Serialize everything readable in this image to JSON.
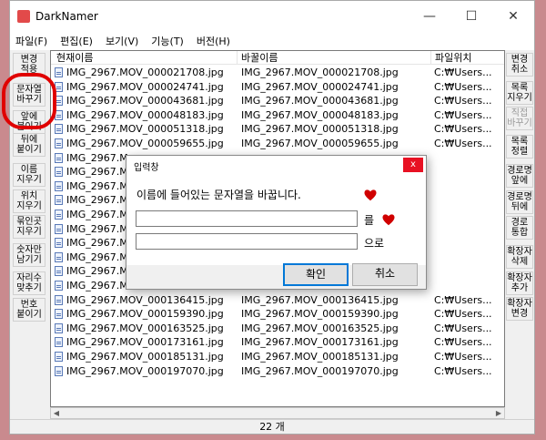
{
  "window": {
    "title": "DarkNamer",
    "controls": {
      "minimize": "—",
      "maximize": "☐",
      "close": "✕"
    }
  },
  "menu": [
    "파일(F)",
    "편집(E)",
    "보기(V)",
    "기능(T)",
    "버전(H)"
  ],
  "left_buttons": [
    {
      "label": "변경\n적용",
      "enabled": true
    },
    {
      "label": "문자열\n바꾸기",
      "enabled": true
    },
    {
      "label": "앞에\n붙이기",
      "enabled": true
    },
    {
      "label": "뒤에\n붙이기",
      "enabled": true
    },
    {
      "label": "이름\n지우기",
      "enabled": true
    },
    {
      "label": "위치\n지우기",
      "enabled": true
    },
    {
      "label": "묶인곳\n지우기",
      "enabled": true
    },
    {
      "label": "숫자만\n남기기",
      "enabled": true
    },
    {
      "label": "자리수\n맞추기",
      "enabled": true
    },
    {
      "label": "번호\n붙이기",
      "enabled": true
    }
  ],
  "right_buttons": [
    {
      "label": "변경\n취소",
      "enabled": true
    },
    {
      "label": "목록\n지우기",
      "enabled": true
    },
    {
      "label": "직접\n바꾸기",
      "enabled": false
    },
    {
      "label": "목록\n정렬",
      "enabled": true
    },
    {
      "label": "경로명\n앞에",
      "enabled": true
    },
    {
      "label": "경로명\n뒤에",
      "enabled": true
    },
    {
      "label": "경로\n통합",
      "enabled": true
    },
    {
      "label": "확장자\n삭제",
      "enabled": true
    },
    {
      "label": "확장자\n추가",
      "enabled": true
    },
    {
      "label": "확장자\n변경",
      "enabled": true
    }
  ],
  "list": {
    "columns": [
      "현재이름",
      "바꿀이름",
      "파일위치"
    ],
    "rows": [
      {
        "current": "IMG_2967.MOV_000021708.jpg",
        "new": "IMG_2967.MOV_000021708.jpg",
        "path": "C:₩Users..."
      },
      {
        "current": "IMG_2967.MOV_000024741.jpg",
        "new": "IMG_2967.MOV_000024741.jpg",
        "path": "C:₩Users..."
      },
      {
        "current": "IMG_2967.MOV_000043681.jpg",
        "new": "IMG_2967.MOV_000043681.jpg",
        "path": "C:₩Users..."
      },
      {
        "current": "IMG_2967.MOV_000048183.jpg",
        "new": "IMG_2967.MOV_000048183.jpg",
        "path": "C:₩Users..."
      },
      {
        "current": "IMG_2967.MOV_000051318.jpg",
        "new": "IMG_2967.MOV_000051318.jpg",
        "path": "C:₩Users..."
      },
      {
        "current": "IMG_2967.MOV_000059655.jpg",
        "new": "IMG_2967.MOV_000059655.jpg",
        "path": "C:₩Users..."
      },
      {
        "current": "IMG_2967.M",
        "new": "",
        "path": ""
      },
      {
        "current": "IMG_2967.M",
        "new": "",
        "path": ""
      },
      {
        "current": "IMG_2967.M",
        "new": "",
        "path": ""
      },
      {
        "current": "IMG_2967.M",
        "new": "",
        "path": ""
      },
      {
        "current": "IMG_2967.M",
        "new": "",
        "path": ""
      },
      {
        "current": "IMG_2967.M",
        "new": "",
        "path": ""
      },
      {
        "current": "IMG_2967.M",
        "new": "",
        "path": ""
      },
      {
        "current": "IMG_2967.M",
        "new": "",
        "path": ""
      },
      {
        "current": "IMG_2967.M",
        "new": "",
        "path": ""
      },
      {
        "current": "IMG_2967.M",
        "new": "",
        "path": ""
      },
      {
        "current": "IMG_2967.MOV_000136415.jpg",
        "new": "IMG_2967.MOV_000136415.jpg",
        "path": "C:₩Users..."
      },
      {
        "current": "IMG_2967.MOV_000159390.jpg",
        "new": "IMG_2967.MOV_000159390.jpg",
        "path": "C:₩Users..."
      },
      {
        "current": "IMG_2967.MOV_000163525.jpg",
        "new": "IMG_2967.MOV_000163525.jpg",
        "path": "C:₩Users..."
      },
      {
        "current": "IMG_2967.MOV_000173161.jpg",
        "new": "IMG_2967.MOV_000173161.jpg",
        "path": "C:₩Users..."
      },
      {
        "current": "IMG_2967.MOV_000185131.jpg",
        "new": "IMG_2967.MOV_000185131.jpg",
        "path": "C:₩Users..."
      },
      {
        "current": "IMG_2967.MOV_000197070.jpg",
        "new": "IMG_2967.MOV_000197070.jpg",
        "path": "C:₩Users..."
      }
    ]
  },
  "status": {
    "count": "22 개"
  },
  "dialog": {
    "title": "입력창",
    "message": "이름에 들어있는 문자열을 바꿉니다.",
    "find_value": "",
    "replace_value": "",
    "find_suffix": "를",
    "replace_suffix": "으로",
    "ok_label": "확인",
    "cancel_label": "취소",
    "close_label": "x"
  },
  "colors": {
    "annotation": "#e00000",
    "border": "#c98a8e",
    "accent": "#0078d7"
  }
}
